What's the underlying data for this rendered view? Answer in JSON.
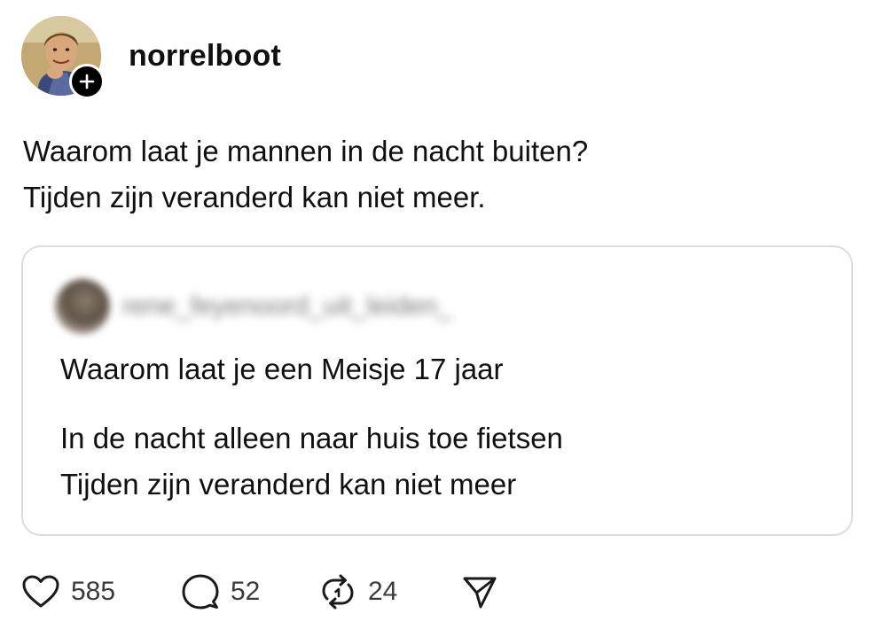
{
  "post": {
    "username": "norrelboot",
    "lines": [
      "Waarom laat je mannen in de nacht buiten?",
      "Tijden zijn veranderd kan niet meer."
    ]
  },
  "quote": {
    "username": "rene_feyenoord_uit_leiden_",
    "lines": [
      "Waarom laat je een Meisje 17 jaar",
      "In de nacht alleen naar huis toe fietsen",
      "Tijden zijn veranderd kan niet meer"
    ]
  },
  "actions": {
    "likes": "585",
    "replies": "52",
    "reposts": "24"
  },
  "icons": {
    "follow": "plus-icon",
    "like": "heart-icon",
    "reply": "comment-bubble-icon",
    "repost": "repost-icon",
    "share": "send-icon"
  }
}
